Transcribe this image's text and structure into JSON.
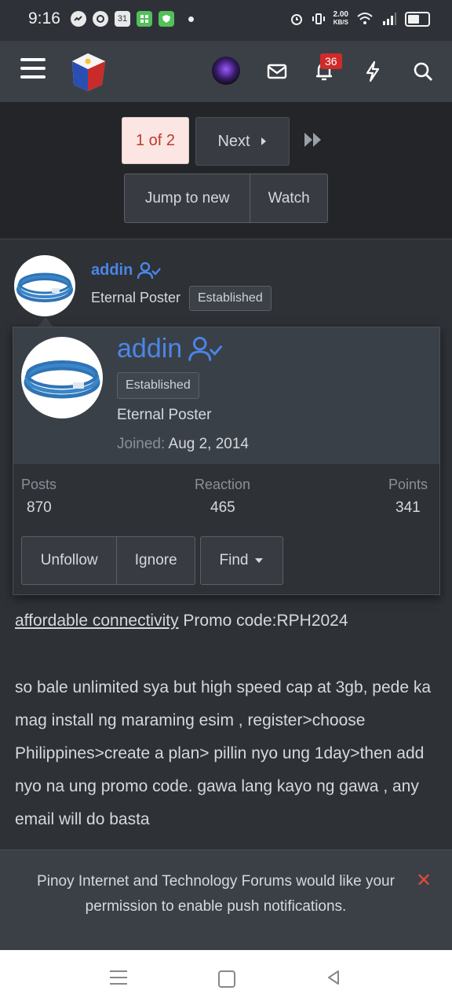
{
  "status_bar": {
    "time": "9:16",
    "calendar_day": "31",
    "net_speed_value": "2.00",
    "net_speed_unit": "KB/S"
  },
  "header": {
    "notification_count": "36"
  },
  "pagination": {
    "current": "1 of 2",
    "next_label": "Next",
    "jump_label": "Jump to new",
    "watch_label": "Watch"
  },
  "post": {
    "username": "addin",
    "user_title": "Eternal Poster",
    "badge": "Established",
    "link_text": "affordable connectivity",
    "promo_text": "Promo code:RPH2024",
    "paragraph": "so bale unlimited sya but high speed cap at 3gb, pede ka mag install ng maraming esim , register>choose Philippines>create a plan> pillin nyo ung 1day>then add nyo na ung promo code. gawa lang kayo ng gawa , any email will do basta"
  },
  "member_card": {
    "username": "addin",
    "badge": "Established",
    "user_title": "Eternal Poster",
    "joined_label": "Joined:",
    "joined_value": "Aug 2, 2014",
    "stats": {
      "posts_label": "Posts",
      "posts_value": "870",
      "reaction_label": "Reaction",
      "reaction_value": "465",
      "points_label": "Points",
      "points_value": "341"
    },
    "unfollow_label": "Unfollow",
    "ignore_label": "Ignore",
    "find_label": "Find"
  },
  "push_banner": {
    "text": "Pinoy Internet and Technology Forums would like your permission to enable push notifications.",
    "close_symbol": "✕"
  },
  "colors": {
    "accent_blue": "#4a86e8",
    "header_bg": "#3b4047",
    "page_bg": "#2e3136",
    "badge_red": "#d12a2a",
    "close_red": "#e04b3c"
  }
}
